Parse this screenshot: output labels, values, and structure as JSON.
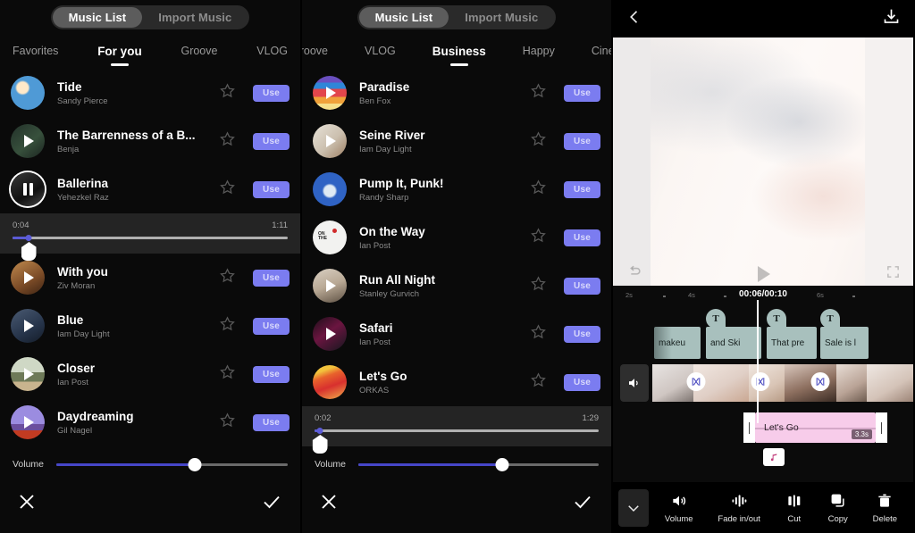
{
  "panel_left": {
    "segmented": {
      "options": [
        "Music List",
        "Import Music"
      ],
      "active": "Music List"
    },
    "categories": [
      "Favorites",
      "For you",
      "Groove",
      "VLOG"
    ],
    "active_category": "For you",
    "tracks": [
      {
        "name": "Tide",
        "artist": "Sandy Pierce",
        "use_label": "Use",
        "state": "none",
        "art": "art-tide"
      },
      {
        "name": "The Barrenness of a B...",
        "artist": "Benja",
        "use_label": "Use",
        "state": "play",
        "art": "art-barrenness"
      },
      {
        "name": "Ballerina",
        "artist": "Yehezkel Raz",
        "use_label": "Use",
        "state": "pause",
        "art": "art-ballerina"
      },
      {
        "name": "With you",
        "artist": "Ziv Moran",
        "use_label": "Use",
        "state": "play",
        "art": "art-withyou"
      },
      {
        "name": "Blue",
        "artist": "Iam Day Light",
        "use_label": "Use",
        "state": "play",
        "art": "art-blue"
      },
      {
        "name": "Closer",
        "artist": "Ian Post",
        "use_label": "Use",
        "state": "play",
        "art": "art-closer"
      },
      {
        "name": "Daydreaming",
        "artist": "Gil Nagel",
        "use_label": "Use",
        "state": "play",
        "art": "art-daydreaming"
      }
    ],
    "playback": {
      "current_time": "0:04",
      "total_time": "1:11",
      "progress_percent": 6
    },
    "volume": {
      "label": "Volume",
      "percent": 60
    },
    "footer": {
      "cancel": "close-icon",
      "confirm": "check-icon"
    }
  },
  "panel_middle": {
    "segmented": {
      "options": [
        "Music List",
        "Import Music"
      ],
      "active": "Music List"
    },
    "categories": [
      "Groove",
      "VLOG",
      "Business",
      "Happy",
      "Cinem"
    ],
    "active_category": "Business",
    "tracks": [
      {
        "name": "Paradise",
        "artist": "Ben Fox",
        "use_label": "Use",
        "state": "play",
        "art": "art-paradise"
      },
      {
        "name": "Seine River",
        "artist": "Iam Day Light",
        "use_label": "Use",
        "state": "play",
        "art": "art-seine"
      },
      {
        "name": "Pump It, Punk!",
        "artist": "Randy Sharp",
        "use_label": "Use",
        "state": "none",
        "art": "art-pump"
      },
      {
        "name": "On the Way",
        "artist": "Ian Post",
        "use_label": "Use",
        "state": "none",
        "art": "art-ontheway"
      },
      {
        "name": "Run All Night",
        "artist": "Stanley Gurvich",
        "use_label": "Use",
        "state": "play",
        "art": "art-runallnight"
      },
      {
        "name": "Safari",
        "artist": "Ian Post",
        "use_label": "Use",
        "state": "play",
        "art": "art-safari"
      },
      {
        "name": "Let's Go",
        "artist": "ORKAS",
        "use_label": "Use",
        "state": "none",
        "art": "art-letsgo"
      }
    ],
    "playback": {
      "current_time": "0:02",
      "total_time": "1:29",
      "progress_percent": 2
    },
    "volume": {
      "label": "Volume",
      "percent": 60
    },
    "footer": {
      "cancel": "close-icon",
      "confirm": "check-icon"
    }
  },
  "panel_editor": {
    "topbar": {
      "back": "back-chevron-icon",
      "export": "download-icon"
    },
    "preview_controls": {
      "undo": "undo-icon",
      "play": "play-icon",
      "fullscreen": "fullscreen-icon"
    },
    "timeline": {
      "timecode": "00:06/00:10",
      "ruler_ticks": [
        "2s",
        "4s",
        "6s"
      ],
      "text_clips": [
        {
          "label": "makeu",
          "badge": ""
        },
        {
          "label": "and Ski",
          "badge": "T"
        },
        {
          "label": "That pre",
          "badge": "T"
        },
        {
          "label": "Sale is l",
          "badge": "T"
        }
      ],
      "transition_icon": "transition-icon",
      "track_volume_icon": "speaker-icon",
      "audio_clip": {
        "name": "Let's Go",
        "duration_badge": "3.3s"
      },
      "note_icon": "music-note-icon"
    },
    "toolbar": {
      "collapse": "chevron-down-icon",
      "tools": [
        {
          "label": "Volume",
          "icon": "speaker-icon"
        },
        {
          "label": "Fade in/out",
          "icon": "fade-icon"
        },
        {
          "label": "Cut",
          "icon": "cut-icon"
        },
        {
          "label": "Copy",
          "icon": "copy-icon"
        },
        {
          "label": "Delete",
          "icon": "trash-icon"
        }
      ]
    }
  },
  "colors": {
    "accent": "#7b7cf0",
    "slider": "#4646c8",
    "clip_text": "#a8c0bd",
    "clip_audio": "#f7ccea"
  }
}
